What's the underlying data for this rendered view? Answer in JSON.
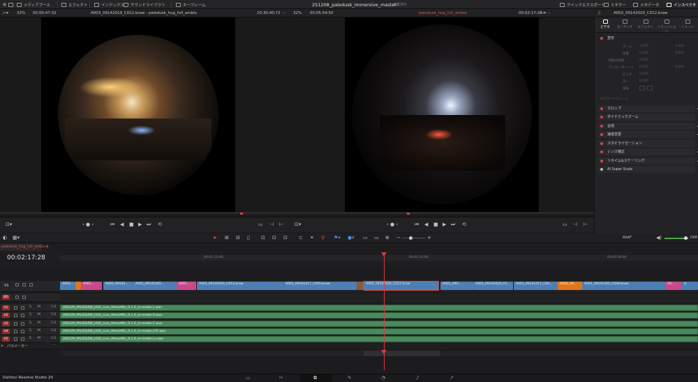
{
  "topbar": {
    "items": [
      {
        "name": "media-pool",
        "label": "メディアプール"
      },
      {
        "name": "effects",
        "label": "エフェクト"
      },
      {
        "name": "index",
        "label": "インデックス"
      },
      {
        "name": "sound-library",
        "label": "サウンドライブラリ"
      },
      {
        "name": "keyframes",
        "label": "キーフレーム"
      }
    ],
    "project_title": "251208_paledusk_immersive_master",
    "project_status": "編集済み",
    "right_items": [
      {
        "name": "quick-export",
        "label": "クイックエクスポート"
      },
      {
        "name": "mixer",
        "label": "ミキサー"
      },
      {
        "name": "metadata",
        "label": "メタデータ"
      },
      {
        "name": "inspector",
        "label": "インスペクタ"
      }
    ]
  },
  "source_viewer": {
    "zoom": "32%",
    "duration": "00:00:47:32",
    "clip_name": "A003_09142019_C012.braw - paledusk_hug_full_ambix",
    "timecode": "20:30:40:72"
  },
  "timeline_viewer": {
    "zoom": "32%",
    "duration": "00:05:54:50",
    "timeline_name": "paledusk_hug_full_ambix",
    "timecode": "00:02:17:28"
  },
  "inspector": {
    "clip_name": "A002_09142020_C012.braw",
    "tabs": [
      "ビデオ",
      "オーディオ",
      "エフェクト",
      "トランジション",
      "イメージ"
    ],
    "transform_section": "変形",
    "props": [
      {
        "label": "ズーム",
        "x": "1.000",
        "y": "1.000"
      },
      {
        "label": "位置",
        "x": "0.000",
        "y": "0.000"
      },
      {
        "label": "回転の角度",
        "x": "0.000",
        "y": ""
      },
      {
        "label": "アンカーポイント",
        "x": "0.000",
        "y": "0.000"
      },
      {
        "label": "ピッチ",
        "x": "0.000",
        "y": ""
      },
      {
        "label": "ヨー",
        "x": "0.000",
        "y": ""
      },
      {
        "label": "反転",
        "x": "",
        "y": ""
      }
    ],
    "keyframe_label": "AIスマートフレーム",
    "sections": [
      "クロップ",
      "ダイナミックズーム",
      "合成",
      "速度変更",
      "スタビライゼーション",
      "レンズ補正",
      "リタイム&スケーリング",
      "AI Super Scale"
    ]
  },
  "toolbar2": {
    "audio_label": "ASAF",
    "dim_label": "DIM"
  },
  "timeline": {
    "tab_name": "paledusk_hug_full_ambix",
    "timecode": "00:02:17:28",
    "ruler": [
      "00:01:12:00",
      "00:02:24:00",
      "00:03:36:00"
    ],
    "video_track": "V1",
    "video_clips": [
      {
        "label": "A003...",
        "color": "blue",
        "start": 0,
        "width": 22
      },
      {
        "label": "",
        "color": "orange",
        "start": 22,
        "width": 8
      },
      {
        "label": "A001...",
        "color": "pink",
        "start": 30,
        "width": 30
      },
      {
        "label": "A003_09142...",
        "color": "blue",
        "start": 62,
        "width": 43
      },
      {
        "label": "A001_09141405...",
        "color": "blue",
        "start": 105,
        "width": 62
      },
      {
        "label": "A001...",
        "color": "pink",
        "start": 167,
        "width": 28
      },
      {
        "label": "A003_09142019_C012.braw",
        "color": "blue",
        "start": 196,
        "width": 124
      },
      {
        "label": "A001_09141417_C005.braw",
        "color": "blue",
        "start": 320,
        "width": 105
      },
      {
        "label": "",
        "color": "brown",
        "start": 425,
        "width": 10
      },
      {
        "label": "A002_09142020_C012.braw",
        "color": "blue",
        "start": 435,
        "width": 107
      },
      {
        "label": "A001_091...",
        "color": "blue",
        "start": 545,
        "width": 47
      },
      {
        "label": "A003_09142019_C0...",
        "color": "blue",
        "start": 592,
        "width": 57
      },
      {
        "label": "A001_09141417_C00...",
        "color": "blue",
        "start": 650,
        "width": 63
      },
      {
        "label": "A003_09...",
        "color": "orange",
        "start": 713,
        "width": 35
      },
      {
        "label": "A001_09141405_C004.braw",
        "color": "blue",
        "start": 748,
        "width": 119
      },
      {
        "label": "A0...",
        "color": "pink",
        "start": 867,
        "width": 24
      },
      {
        "label": "A",
        "color": "blue",
        "start": 891,
        "width": 23
      }
    ],
    "bd_track": "BD",
    "audio_tracks": [
      {
        "id": "A1",
        "level": "1.0",
        "label": "260129_PALEDUSK_HUG_Live_AtmosMix_9.1.4_re-render.L.wav"
      },
      {
        "id": "A2",
        "level": "1.0",
        "label": "260129_PALEDUSK_HUG_Live_AtmosMix_9.1.4_re-render.R.wav"
      },
      {
        "id": "A3",
        "level": "1.0",
        "label": "260129_PALEDUSK_HUG_Live_AtmosMix_9.1.4_re-render.C.wav"
      },
      {
        "id": "A4",
        "level": "1.0",
        "label": "260129_PALEDUSK_HUG_Live_AtmosMix_9.1.4_re-render.LFE.wav"
      },
      {
        "id": "A5",
        "level": "1.0",
        "label": "260129_PALEDUSK_HUG_Live_AtmosMix_9.1.4_re-render.Ls.wav"
      }
    ],
    "param_label": "パラメーター"
  },
  "bottombar": {
    "app_name": "DaVinci Resolve Studio 20"
  }
}
